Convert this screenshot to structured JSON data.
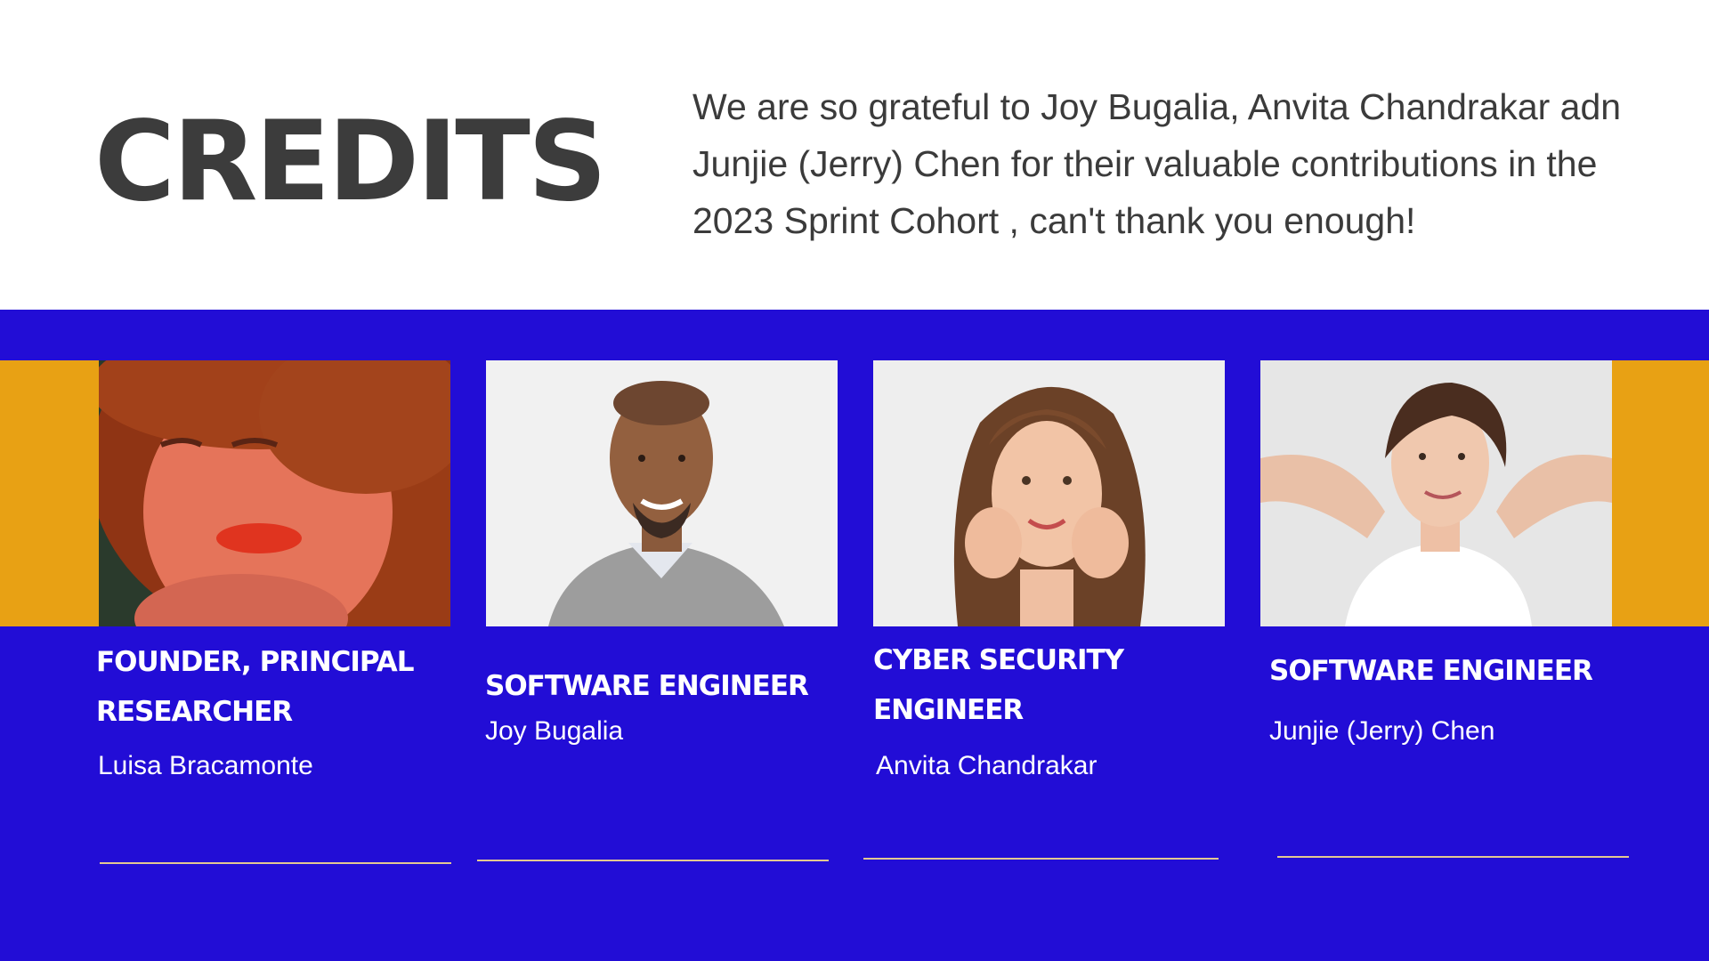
{
  "title": "CREDITS",
  "intro": "We are so grateful to Joy Bugalia, Anvita Chandrakar adn Junjie (Jerry) Chen for their valuable contributions in the 2023 Sprint Cohort , can't thank you enough!",
  "colors": {
    "band": "#220dd6",
    "accent": "#e8a114",
    "title_text": "#3c3c3c",
    "rule": "#e3c892"
  },
  "members": [
    {
      "role": "FOUNDER, PRINCIPAL RESEARCHER",
      "name": "Luisa Bracamonte",
      "photo": "portrait-red-curly-hair-woman"
    },
    {
      "role": "SOFTWARE ENGINEER",
      "name": "Joy Bugalia",
      "photo": "portrait-smiling-bald-man"
    },
    {
      "role": "CYBER SECURITY ENGINEER",
      "name": "Anvita Chandrakar",
      "photo": "portrait-smiling-woman-long-hair"
    },
    {
      "role": "SOFTWARE ENGINEER",
      "name": "Junjie (Jerry) Chen",
      "photo": "portrait-woman-hands-behind-head"
    }
  ]
}
